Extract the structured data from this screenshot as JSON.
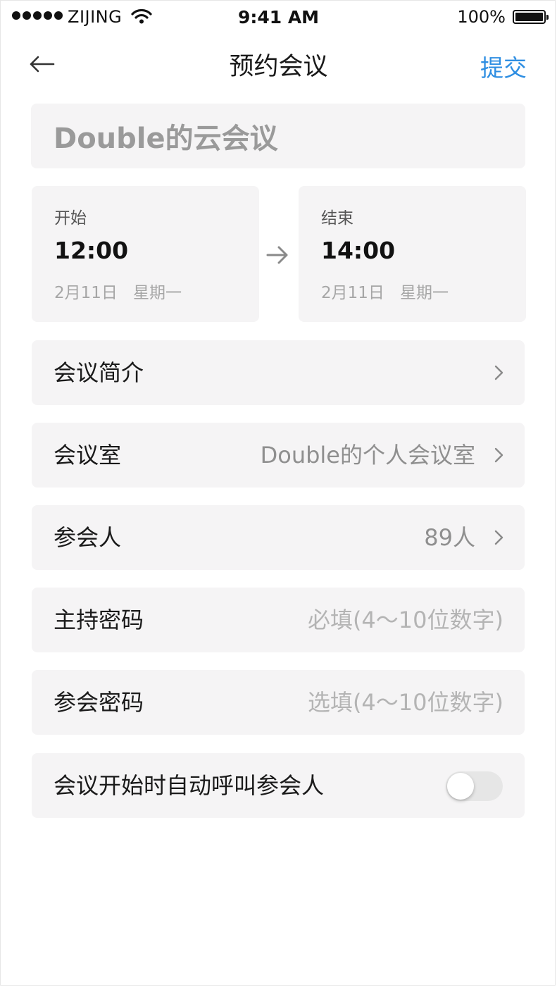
{
  "status_bar": {
    "carrier": "ZIJING",
    "time": "9:41 AM",
    "battery": "100%"
  },
  "nav": {
    "title": "预约会议",
    "submit_label": "提交"
  },
  "meeting": {
    "title_value": "Double的云会议"
  },
  "schedule": {
    "start": {
      "label": "开始",
      "time": "12:00",
      "date": "2月11日",
      "weekday": "星期一"
    },
    "end": {
      "label": "结束",
      "time": "14:00",
      "date": "2月11日",
      "weekday": "星期一"
    }
  },
  "rows": {
    "intro": {
      "label": "会议简介"
    },
    "room": {
      "label": "会议室",
      "value": "Double的个人会议室"
    },
    "participants": {
      "label": "参会人",
      "value": "89人"
    },
    "host_password": {
      "label": "主持密码",
      "placeholder": "必填(4～10位数字)"
    },
    "join_password": {
      "label": "参会密码",
      "placeholder": "选填(4～10位数字)"
    },
    "auto_call": {
      "label": "会议开始时自动呼叫参会人",
      "enabled": false
    }
  },
  "colors": {
    "accent": "#2e8ee2",
    "card_bg": "#f5f4f5"
  },
  "icons": [
    "back-arrow-icon",
    "right-arrow-icon",
    "chevron-right-icon",
    "wifi-icon",
    "battery-icon"
  ]
}
